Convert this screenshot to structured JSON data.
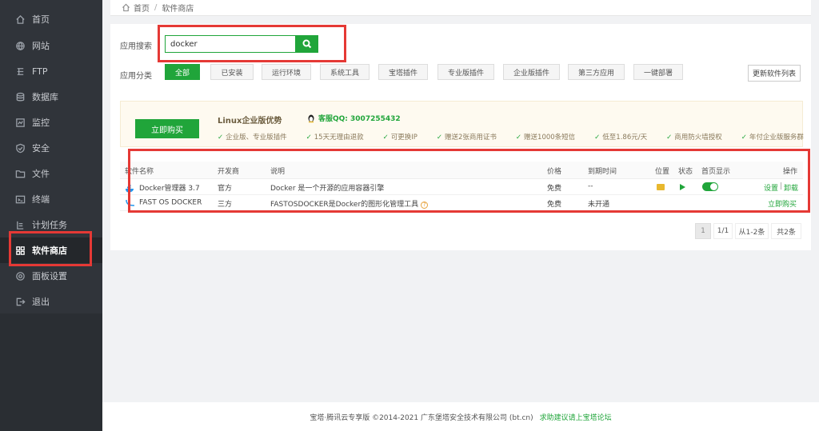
{
  "sidebar": {
    "items": [
      {
        "label": "首页",
        "icon": "home-icon"
      },
      {
        "label": "网站",
        "icon": "globe-icon"
      },
      {
        "label": "FTP",
        "icon": "ftp-icon"
      },
      {
        "label": "数据库",
        "icon": "database-icon"
      },
      {
        "label": "监控",
        "icon": "monitor-icon"
      },
      {
        "label": "安全",
        "icon": "shield-icon"
      },
      {
        "label": "文件",
        "icon": "folder-icon"
      },
      {
        "label": "终端",
        "icon": "terminal-icon"
      },
      {
        "label": "计划任务",
        "icon": "clock-icon"
      },
      {
        "label": "软件商店",
        "icon": "grid-icon",
        "active": true
      },
      {
        "label": "面板设置",
        "icon": "gear-icon"
      },
      {
        "label": "退出",
        "icon": "logout-icon"
      }
    ]
  },
  "breadcrumb": {
    "home": "首页",
    "separator": "/",
    "current": "软件商店"
  },
  "search": {
    "label": "应用搜索",
    "value": "docker"
  },
  "categories": {
    "label": "应用分类",
    "items": [
      "全部",
      "已安装",
      "运行环境",
      "系统工具",
      "宝塔插件",
      "专业版插件",
      "企业版插件",
      "第三方应用",
      "一键部署"
    ],
    "refresh": "更新软件列表"
  },
  "promo": {
    "buy": "立即购买",
    "title": "Linux企业版优势",
    "qq": "客服QQ: 3007255432",
    "features": [
      "企业版、专业版插件",
      "15天无理由退款",
      "可更换IP",
      "赠送2张商用证书",
      "赠送1000条短信",
      "低至1.86元/天",
      "商用防火墙授权",
      "年付企业版服务群"
    ]
  },
  "table": {
    "headers": {
      "name": "软件名称",
      "dev": "开发商",
      "desc": "说明",
      "price": "价格",
      "expire": "到期时间",
      "location": "位置",
      "status": "状态",
      "home": "首页显示",
      "action": "操作"
    },
    "rows": [
      {
        "name": "Docker管理器 3.7",
        "dev": "官方",
        "desc": "Docker 是一个开源的应用容器引擎",
        "price": "免费",
        "expire": "--",
        "act_settings": "设置",
        "act_sep": "|",
        "act_uninstall": "卸载"
      },
      {
        "name": "FAST OS DOCKER",
        "dev": "三方",
        "desc": "FASTOSDOCKER是Docker的图形化管理工具",
        "price": "免费",
        "expire": "未开通",
        "act_buy": "立即购买"
      }
    ]
  },
  "pagination": {
    "current": "1",
    "pages": "1/1",
    "range": "从1-2条",
    "total": "共2条"
  },
  "footer": {
    "copyright": "宝塔·腾讯云专享版 ©2014-2021 广东堡塔安全技术有限公司 (bt.cn)",
    "link": "求助建议请上宝塔论坛"
  },
  "colors": {
    "accent": "#20a53a",
    "highlight": "#e53935",
    "sidebar": "#30343a"
  }
}
